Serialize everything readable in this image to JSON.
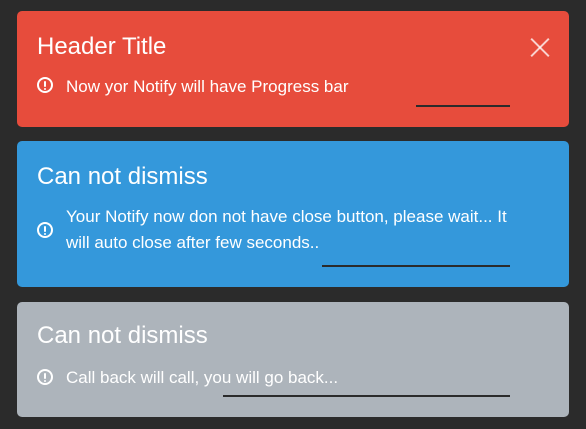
{
  "colors": {
    "background": "#2b2b2b",
    "error": "#e74c3c",
    "info": "#3498db",
    "muted": "#adb4bb",
    "text": "#ffffff",
    "progress": "#2b2b2b"
  },
  "notifications": [
    {
      "title": "Header Title",
      "message": "Now yor Notify will have Progress bar",
      "icon": "info-circle-icon",
      "closable": true,
      "progress": 0.17
    },
    {
      "title": "Can not dismiss",
      "message": "Your Notify now don not have close button, please wait... It will auto close after few seconds..",
      "icon": "info-circle-icon",
      "closable": false,
      "progress": 0.34
    },
    {
      "title": "Can not dismiss",
      "message": "Call back will call, you will go back...",
      "icon": "info-circle-icon",
      "closable": false,
      "progress": 0.52
    }
  ]
}
